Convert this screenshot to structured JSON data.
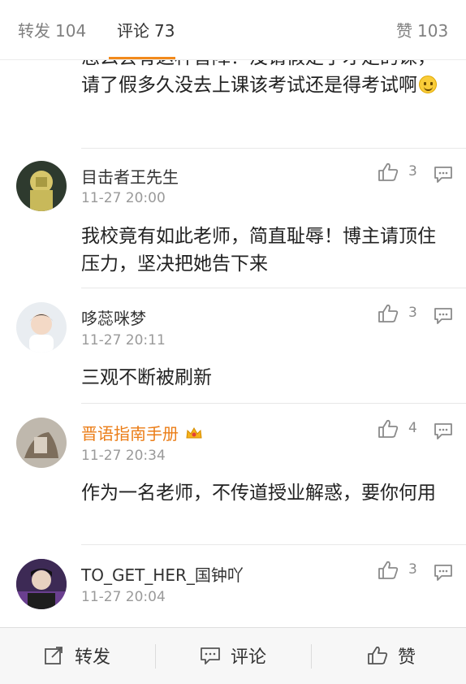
{
  "tabs": {
    "repost": {
      "label": "转发",
      "count": "104"
    },
    "comment": {
      "label": "评论",
      "count": "73"
    },
    "like": {
      "label": "赞",
      "count": "103"
    }
  },
  "colors": {
    "accent": "#f28a1c",
    "orange_name": "#eb7d17",
    "time_gray": "#9a9a9a"
  },
  "top_comment_text": "怎么会有这种智障？没请假走了才走的课，请了假多久没去上课该考试还是得考试啊",
  "comments": [
    {
      "user": "目击者王先生",
      "time": "11-27 20:00",
      "likes": "3",
      "text": "我校竟有如此老师，简直耻辱！博主请顶住压力，坚决把她告下来"
    },
    {
      "user": "哆蕊咪梦",
      "time": "11-27 20:11",
      "likes": "3",
      "text": "三观不断被刷新"
    },
    {
      "user": "晋语指南手册",
      "time": "11-27 20:34",
      "likes": "4",
      "text": "作为一名老师，不传道授业解惑，要你何用",
      "vip": true
    },
    {
      "user": "TO_GET_HER_国钟吖",
      "time": "11-27 20:04",
      "likes": "3",
      "text": ""
    }
  ],
  "bottom_bar": {
    "repost": "转发",
    "comment": "评论",
    "like": "赞"
  },
  "icons": [
    "thumb-up-icon",
    "reply-icon",
    "repost-icon",
    "comment-icon",
    "smile-emoji-icon",
    "crown-badge-icon"
  ]
}
